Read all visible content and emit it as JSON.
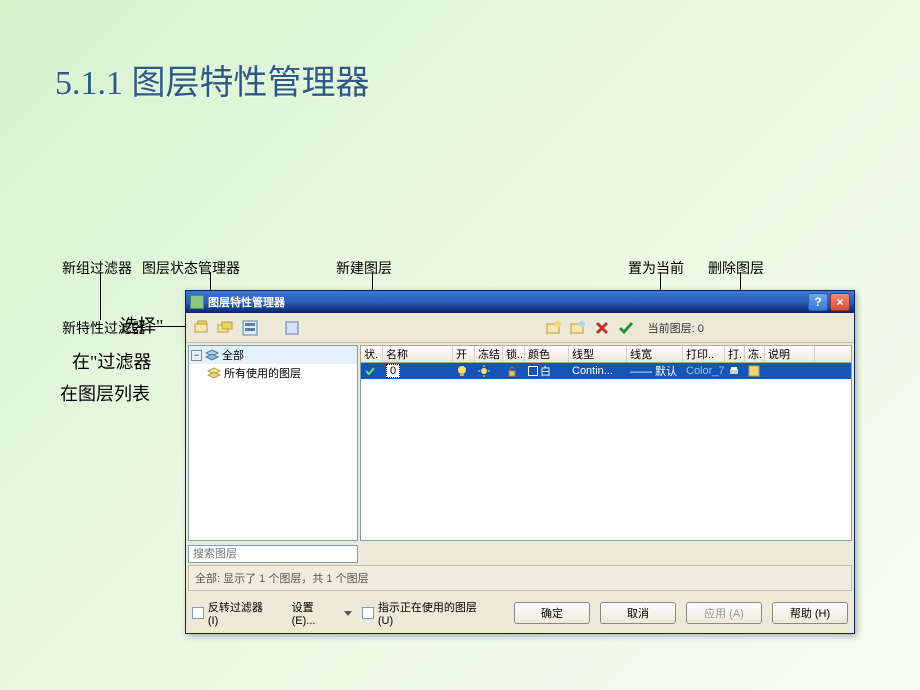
{
  "slide": {
    "title": "5.1.1  图层特性管理器"
  },
  "annotations": {
    "newGroupFilter": "新组过滤器",
    "layerStateManager": "图层状态管理器",
    "newLayer": "新建图层",
    "setCurrent": "置为当前",
    "deleteLayer": "删除图层",
    "newPropFilter": "新特性过滤器",
    "select": "选择\"",
    "filterIn": "在\"过滤器",
    "layerList": "在图层列表"
  },
  "dialog": {
    "title": "图层特性管理器",
    "currentLayerLabel": "当前图层: 0",
    "tree": {
      "root": "全部",
      "child": "所有使用的图层"
    },
    "columns": {
      "status": "状.",
      "name": "名称",
      "on": "开",
      "freeze": "冻结",
      "lock": "锁..",
      "color": "颜色",
      "linetype": "线型",
      "lineweight": "线宽",
      "plotstyle": "打印..",
      "print": "打.",
      "freeze2": "冻.",
      "description": "说明"
    },
    "rows": [
      {
        "name": "0",
        "on": true,
        "freeze": false,
        "lock": false,
        "colorSwatch": "#000000",
        "colorName": "白",
        "linetype": "Contin...",
        "lineweight": "—— 默认",
        "plotstyle": "Color_7"
      }
    ],
    "searchPlaceholder": "搜索图层",
    "status": "全部: 显示了 1 个图层，共 1 个图层",
    "invertFilter": "反转过滤器 (I)",
    "indicateInUse": "指示正在使用的图层 (U)",
    "settings": "设置 (E)...",
    "ok": "确定",
    "cancel": "取消",
    "apply": "应用 (A)",
    "help": "帮助 (H)"
  }
}
